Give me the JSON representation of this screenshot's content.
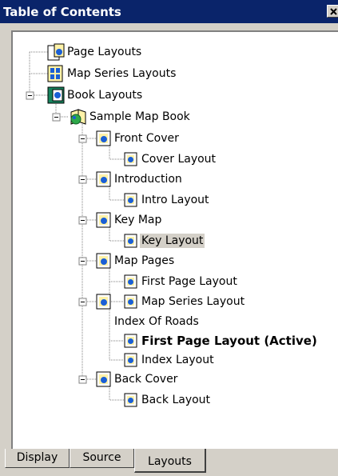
{
  "window": {
    "title": "Table of Contents"
  },
  "tree": {
    "items": [
      {
        "label": "Page Layouts",
        "icon": "page-layouts-icon"
      },
      {
        "label": "Map Series Layouts",
        "icon": "map-series-layouts-icon"
      },
      {
        "label": "Book Layouts",
        "icon": "book-layouts-icon",
        "expander": "minus"
      },
      {
        "label": "Sample Map Book",
        "icon": "map-book-icon",
        "expander": "minus"
      },
      {
        "label": "Front Cover",
        "icon": "section-icon",
        "expander": "minus"
      },
      {
        "label": "Cover Layout",
        "icon": "layout-page-icon"
      },
      {
        "label": "Introduction",
        "icon": "section-icon",
        "expander": "minus"
      },
      {
        "label": "Intro Layout",
        "icon": "layout-page-icon"
      },
      {
        "label": "Key Map",
        "icon": "section-icon",
        "expander": "minus"
      },
      {
        "label": "Key Layout",
        "icon": "layout-page-icon",
        "selected": true
      },
      {
        "label": "Map Pages",
        "icon": "section-icon",
        "expander": "minus"
      },
      {
        "label": "First Page Layout",
        "icon": "layout-page-icon"
      },
      {
        "label": "Map Series Layout",
        "icon": "layout-page-icon"
      },
      {
        "label": "Index Of Roads",
        "icon": "section-icon",
        "expander": "minus"
      },
      {
        "label": "First Page Layout (Active)",
        "icon": "layout-page-icon",
        "active": true
      },
      {
        "label": "Index Layout",
        "icon": "layout-page-icon"
      },
      {
        "label": "Back Cover",
        "icon": "section-icon",
        "expander": "minus"
      },
      {
        "label": "Back Layout",
        "icon": "layout-page-icon"
      }
    ]
  },
  "tabs": [
    {
      "label": "Display"
    },
    {
      "label": "Source"
    },
    {
      "label": "Layouts",
      "active": true
    }
  ],
  "colors": {
    "title_bar": "#0a246a",
    "panel_bg": "#d4d0c8",
    "tree_bg": "#ffffff",
    "selection_bg": "#d4d0c8"
  }
}
